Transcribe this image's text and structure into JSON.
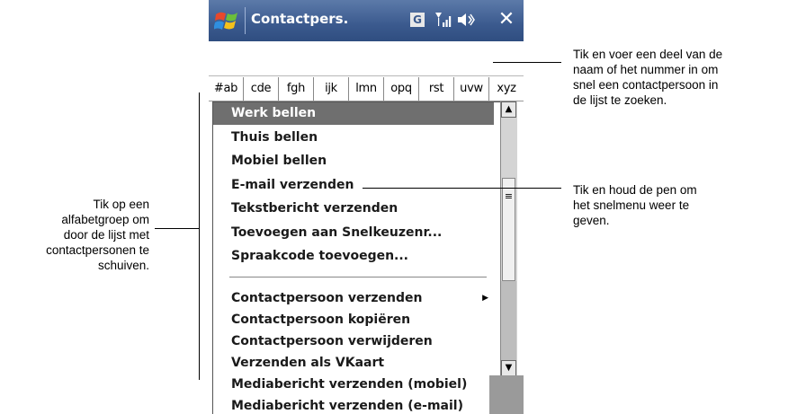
{
  "titlebar": {
    "title": "Contactpers.",
    "status_g": "G",
    "close_symbol": "✕",
    "icons": [
      "windows-start-icon",
      "signal-icon",
      "volume-icon"
    ]
  },
  "search": {
    "value": "",
    "placeholder": ""
  },
  "alphabet_tabs": [
    "#ab",
    "cde",
    "fgh",
    "ijk",
    "lmn",
    "opq",
    "rst",
    "uvw",
    "xyz"
  ],
  "menu": {
    "group1": [
      "Werk bellen",
      "Thuis bellen",
      "Mobiel bellen",
      "E-mail verzenden",
      "Tekstbericht verzenden",
      "Toevoegen aan Snelkeuzenr...",
      "Spraakcode toevoegen..."
    ],
    "group2": [
      "Contactpersoon verzenden",
      "Contactpersoon kopiëren",
      "Contactpersoon verwijderen",
      "Verzenden als VKaart",
      "Mediabericht verzenden (mobiel)",
      "Mediabericht verzenden (e-mail)"
    ],
    "selected": "Werk bellen"
  },
  "scrollbar": {
    "up": "▲",
    "down": "▼",
    "grip": "≡"
  },
  "callouts": {
    "search_hint": "Tik en voer een deel van de\nnaam of het nummer in om\nsnel een contactpersoon in\nde lijst te zoeken.",
    "menu_hint": "Tik en houd de pen om\nhet snelmenu weer te\ngeven.",
    "alpha_hint": "Tik op een\nalfabetgroep om\ndoor de lijst met\ncontactpersonen te\nschuiven."
  },
  "colors": {
    "titlebar": "#3b5a8e",
    "selection": "#6f6f6f"
  }
}
